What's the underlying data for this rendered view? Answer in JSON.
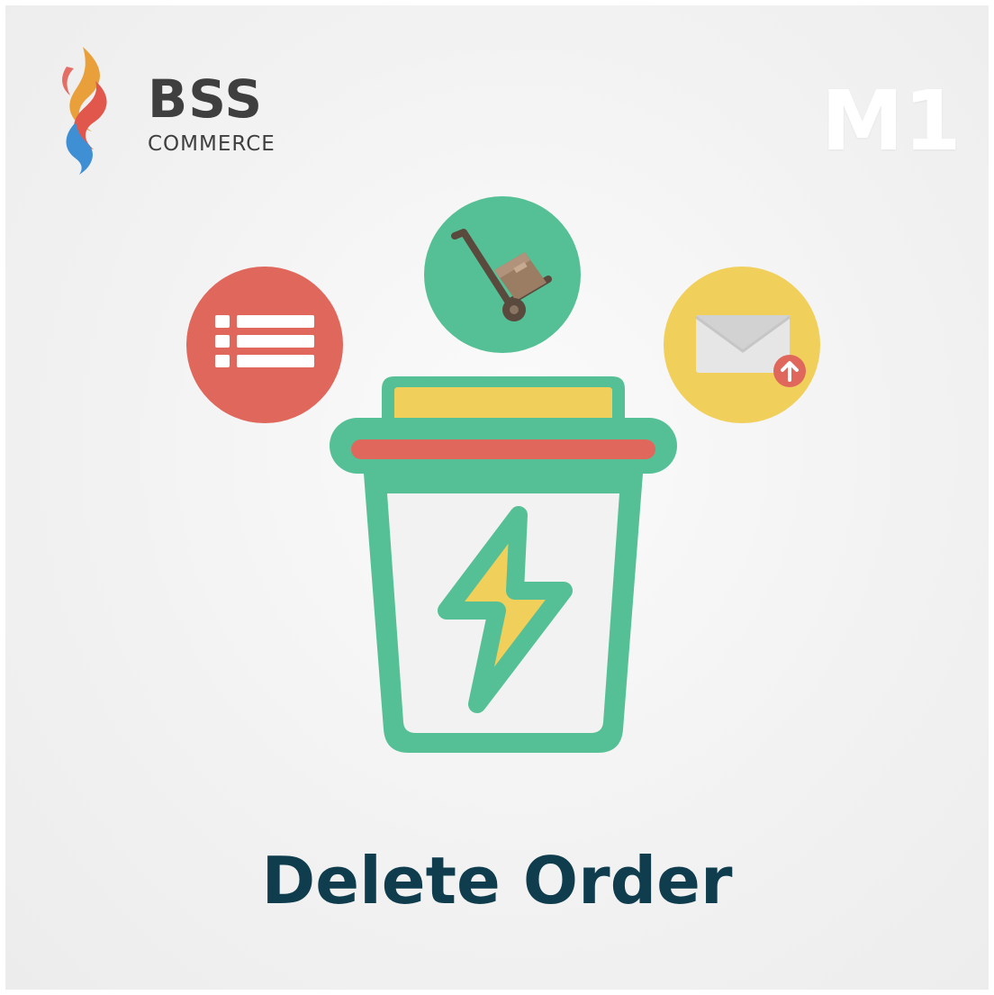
{
  "brand": {
    "name": "BSS",
    "subtitle": "COMMERCE"
  },
  "version_badge": "M1",
  "title": "Delete Order",
  "icons": {
    "list": "list-icon",
    "cart": "hand-truck-icon",
    "mail": "envelope-upload-icon",
    "trash": "trash-bin-icon",
    "bolt": "lightning-bolt-icon"
  },
  "colors": {
    "red": "#e0675b",
    "green": "#55c095",
    "yellow": "#f1cf5b",
    "title": "#0f3d4e",
    "brand_text": "#3f3f3f"
  }
}
